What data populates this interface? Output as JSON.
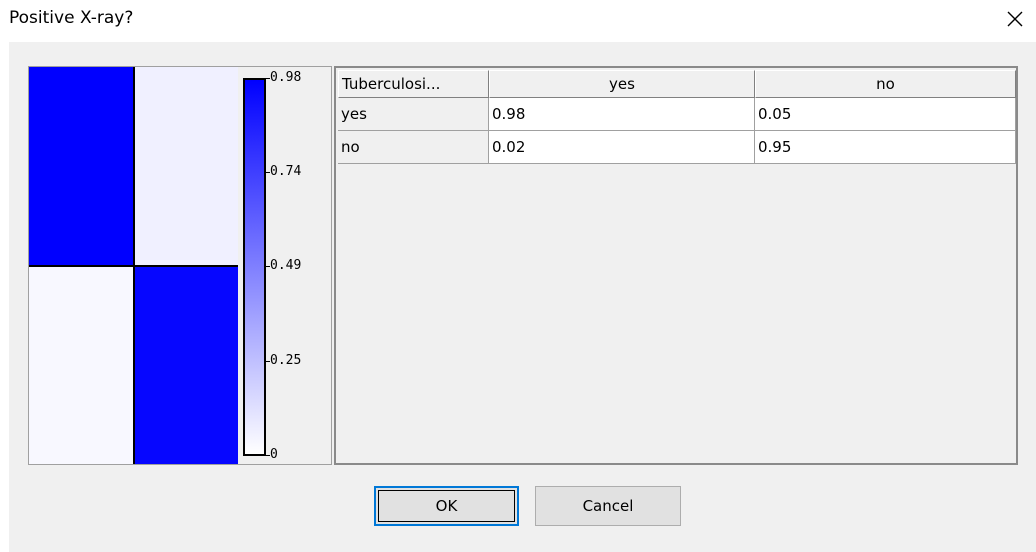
{
  "window": {
    "title": "Positive X-ray?"
  },
  "heatmap": {
    "cells": [
      {
        "row": 0,
        "col": 0,
        "value": 0.98,
        "color": "#0000ff"
      },
      {
        "row": 0,
        "col": 1,
        "value": 0.05,
        "color": "#f0f0ff"
      },
      {
        "row": 1,
        "col": 0,
        "value": 0.02,
        "color": "#f8f8ff"
      },
      {
        "row": 1,
        "col": 1,
        "value": 0.95,
        "color": "#0606ff"
      }
    ],
    "colorbar": {
      "min": 0,
      "max": 0.98,
      "color_low": "#ffffff",
      "color_high": "#0000ff",
      "ticks": [
        "0.98",
        "0.74",
        "0.49",
        "0.25",
        "0"
      ]
    }
  },
  "table": {
    "header": [
      "Tuberculosi...",
      "yes",
      "no"
    ],
    "rows": [
      [
        "yes",
        "0.98",
        "0.05"
      ],
      [
        "no",
        "0.02",
        "0.95"
      ]
    ]
  },
  "buttons": {
    "ok": "OK",
    "cancel": "Cancel"
  }
}
